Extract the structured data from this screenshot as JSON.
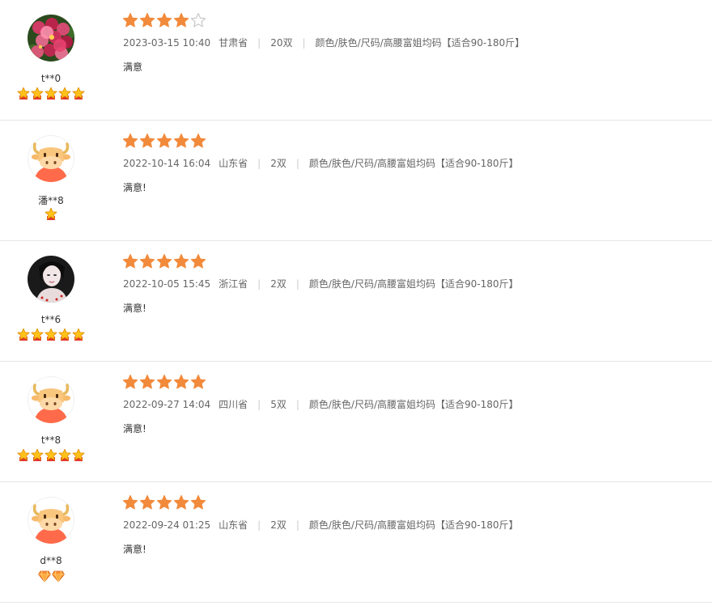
{
  "colors": {
    "star": "#F28A3B",
    "star_empty_stroke": "#BDBDBD",
    "divider": "#E6E6E6",
    "meta_text": "#666666"
  },
  "reviews": [
    {
      "username": "t**0",
      "rating": 4,
      "max_rating": 5,
      "date": "2023-03-15 10:40",
      "province": "甘肃省",
      "quantity": "20双",
      "sku": "颜色/肤色/尺码/高腰富姐均码【适合90-180斤】",
      "content": "满意",
      "avatar": "flower-photo-avatar",
      "level": {
        "type": "crown",
        "count": 5
      }
    },
    {
      "username": "潘**8",
      "rating": 5,
      "max_rating": 5,
      "date": "2022-10-14 16:04",
      "province": "山东省",
      "quantity": "2双",
      "sku": "颜色/肤色/尺码/高腰富姐均码【适合90-180斤】",
      "content": "满意!",
      "avatar": "bull-avatar",
      "level": {
        "type": "crown",
        "count": 1
      }
    },
    {
      "username": "t**6",
      "rating": 5,
      "max_rating": 5,
      "date": "2022-10-05 15:45",
      "province": "浙江省",
      "quantity": "2双",
      "sku": "颜色/肤色/尺码/高腰富姐均码【适合90-180斤】",
      "content": "满意!",
      "avatar": "portrait-photo-avatar",
      "level": {
        "type": "crown",
        "count": 5
      }
    },
    {
      "username": "t**8",
      "rating": 5,
      "max_rating": 5,
      "date": "2022-09-27 14:04",
      "province": "四川省",
      "quantity": "5双",
      "sku": "颜色/肤色/尺码/高腰富姐均码【适合90-180斤】",
      "content": "满意!",
      "avatar": "bull-avatar",
      "level": {
        "type": "crown",
        "count": 5
      }
    },
    {
      "username": "d**8",
      "rating": 5,
      "max_rating": 5,
      "date": "2022-09-24 01:25",
      "province": "山东省",
      "quantity": "2双",
      "sku": "颜色/肤色/尺码/高腰富姐均码【适合90-180斤】",
      "content": "满意!",
      "avatar": "bull-avatar",
      "level": {
        "type": "diamond",
        "count": 2
      }
    }
  ]
}
